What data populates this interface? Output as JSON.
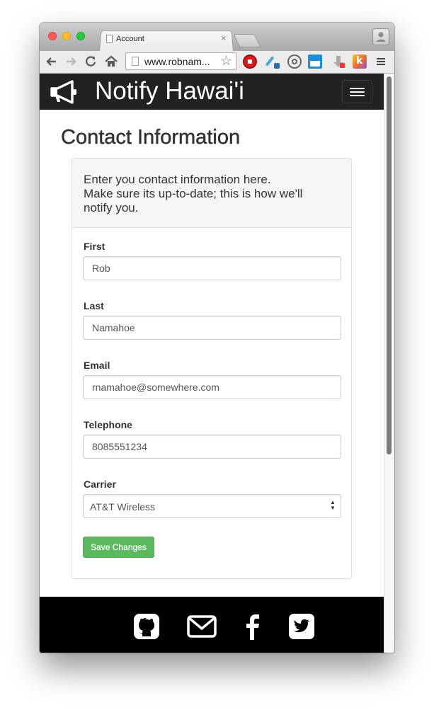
{
  "browser": {
    "tab_title": "Account",
    "tab_close_glyph": "×",
    "url": "www.robnam...",
    "icons": [
      "back-icon",
      "forward-icon",
      "reload-icon",
      "home-icon",
      "bookmark-star-icon",
      "adblock-stop-icon",
      "eyedropper-icon",
      "circle-extension-icon",
      "square-extension-icon",
      "download-extension-icon",
      "k-extension-icon",
      "menu-icon",
      "profile-icon"
    ]
  },
  "navbar": {
    "brand": "Notify Hawai'i",
    "logo_icon": "megaphone-icon",
    "toggle_icon": "hamburger-icon"
  },
  "page": {
    "title": "Contact Information"
  },
  "panel": {
    "heading_line1": "Enter you contact information here.",
    "heading_line2": "Make sure its up-to-date; this is how we'll",
    "heading_line3": "notify you."
  },
  "form": {
    "first": {
      "label": "First",
      "value": "Rob"
    },
    "last": {
      "label": "Last",
      "value": "Namahoe"
    },
    "email": {
      "label": "Email",
      "value": "rnamahoe@somewhere.com"
    },
    "telephone": {
      "label": "Telephone",
      "value": "8085551234"
    },
    "carrier": {
      "label": "Carrier",
      "value": "AT&T Wireless"
    },
    "save_label": "Save Changes"
  },
  "footer": {
    "icons": [
      "github-icon",
      "mail-icon",
      "facebook-icon",
      "twitter-icon"
    ]
  },
  "colors": {
    "navbar_bg": "#222222",
    "footer_bg": "#000000",
    "save_button": "#5cb85c",
    "panel_heading_bg": "#f5f5f5"
  }
}
